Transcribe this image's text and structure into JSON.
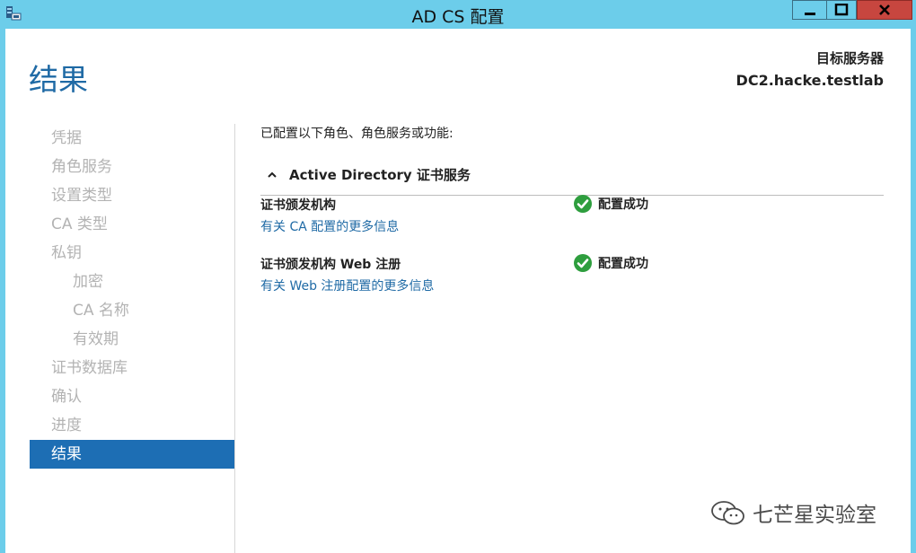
{
  "window": {
    "title": "AD CS 配置"
  },
  "page": {
    "heading": "结果",
    "server_label": "目标服务器",
    "server_name": "DC2.hacke.testlab"
  },
  "nav": {
    "items": [
      {
        "label": "凭据",
        "state": "disabled"
      },
      {
        "label": "角色服务",
        "state": "disabled"
      },
      {
        "label": "设置类型",
        "state": "disabled"
      },
      {
        "label": "CA 类型",
        "state": "disabled"
      },
      {
        "label": "私钥",
        "state": "disabled"
      },
      {
        "label": "加密",
        "state": "disabled",
        "indent": true
      },
      {
        "label": "CA 名称",
        "state": "disabled",
        "indent": true
      },
      {
        "label": "有效期",
        "state": "disabled",
        "indent": true
      },
      {
        "label": "证书数据库",
        "state": "disabled"
      },
      {
        "label": "确认",
        "state": "disabled"
      },
      {
        "label": "进度",
        "state": "disabled"
      },
      {
        "label": "结果",
        "state": "active"
      }
    ]
  },
  "content": {
    "intro": "已配置以下角色、角色服务或功能:",
    "section_title": "Active Directory 证书服务",
    "results": [
      {
        "role": "证书颁发机构",
        "link": "有关 CA 配置的更多信息",
        "status": "配置成功"
      },
      {
        "role": "证书颁发机构 Web 注册",
        "link": "有关 Web 注册配置的更多信息",
        "status": "配置成功"
      }
    ]
  },
  "watermark": {
    "text": "七芒星实验室"
  },
  "colors": {
    "titlebar": "#6ccdea",
    "accent": "#1f6aa5",
    "nav_active": "#1d6eb4",
    "success": "#2e9e3e",
    "close_button": "#c7463f"
  },
  "icons": {
    "app": "server-manager-icon",
    "minimize": "minimize-icon",
    "maximize": "maximize-icon",
    "close": "close-icon",
    "section_toggle": "chevron-up-icon",
    "status": "check-circle-icon",
    "watermark": "wechat-icon"
  }
}
